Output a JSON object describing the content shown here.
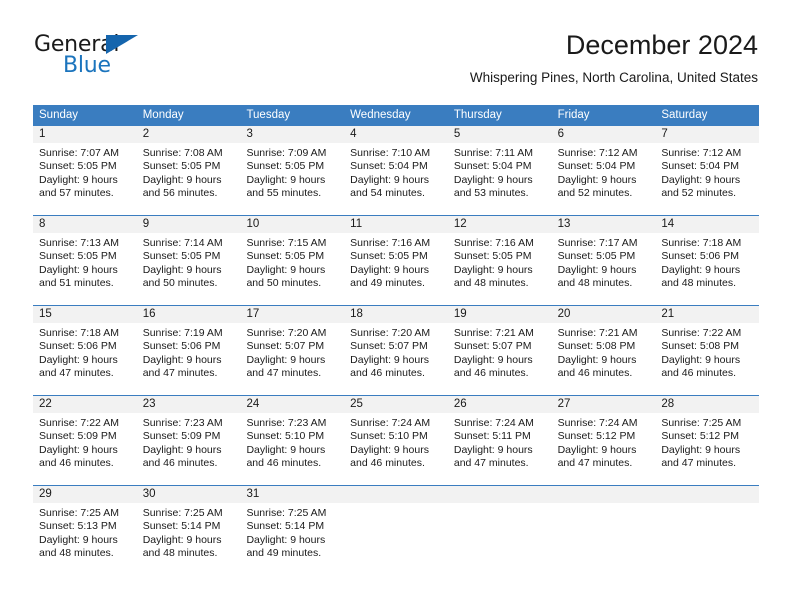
{
  "logo": {
    "word_one": "General",
    "word_two": "Blue",
    "triangle_color": "#1565ad",
    "blue_text_color": "#1b74bd"
  },
  "header": {
    "title": "December 2024",
    "subtitle": "Whispering Pines, North Carolina, United States"
  },
  "theme": {
    "header_bar_color": "#3a7dc0",
    "day_number_band_color": "#f2f2f2",
    "text_color": "#1a1a1a"
  },
  "calendar": {
    "weekday_headers": [
      "Sunday",
      "Monday",
      "Tuesday",
      "Wednesday",
      "Thursday",
      "Friday",
      "Saturday"
    ],
    "weeks": [
      [
        {
          "day": "1",
          "sunrise": "Sunrise: 7:07 AM",
          "sunset": "Sunset: 5:05 PM",
          "daylight_1": "Daylight: 9 hours",
          "daylight_2": "and 57 minutes."
        },
        {
          "day": "2",
          "sunrise": "Sunrise: 7:08 AM",
          "sunset": "Sunset: 5:05 PM",
          "daylight_1": "Daylight: 9 hours",
          "daylight_2": "and 56 minutes."
        },
        {
          "day": "3",
          "sunrise": "Sunrise: 7:09 AM",
          "sunset": "Sunset: 5:05 PM",
          "daylight_1": "Daylight: 9 hours",
          "daylight_2": "and 55 minutes."
        },
        {
          "day": "4",
          "sunrise": "Sunrise: 7:10 AM",
          "sunset": "Sunset: 5:04 PM",
          "daylight_1": "Daylight: 9 hours",
          "daylight_2": "and 54 minutes."
        },
        {
          "day": "5",
          "sunrise": "Sunrise: 7:11 AM",
          "sunset": "Sunset: 5:04 PM",
          "daylight_1": "Daylight: 9 hours",
          "daylight_2": "and 53 minutes."
        },
        {
          "day": "6",
          "sunrise": "Sunrise: 7:12 AM",
          "sunset": "Sunset: 5:04 PM",
          "daylight_1": "Daylight: 9 hours",
          "daylight_2": "and 52 minutes."
        },
        {
          "day": "7",
          "sunrise": "Sunrise: 7:12 AM",
          "sunset": "Sunset: 5:04 PM",
          "daylight_1": "Daylight: 9 hours",
          "daylight_2": "and 52 minutes."
        }
      ],
      [
        {
          "day": "8",
          "sunrise": "Sunrise: 7:13 AM",
          "sunset": "Sunset: 5:05 PM",
          "daylight_1": "Daylight: 9 hours",
          "daylight_2": "and 51 minutes."
        },
        {
          "day": "9",
          "sunrise": "Sunrise: 7:14 AM",
          "sunset": "Sunset: 5:05 PM",
          "daylight_1": "Daylight: 9 hours",
          "daylight_2": "and 50 minutes."
        },
        {
          "day": "10",
          "sunrise": "Sunrise: 7:15 AM",
          "sunset": "Sunset: 5:05 PM",
          "daylight_1": "Daylight: 9 hours",
          "daylight_2": "and 50 minutes."
        },
        {
          "day": "11",
          "sunrise": "Sunrise: 7:16 AM",
          "sunset": "Sunset: 5:05 PM",
          "daylight_1": "Daylight: 9 hours",
          "daylight_2": "and 49 minutes."
        },
        {
          "day": "12",
          "sunrise": "Sunrise: 7:16 AM",
          "sunset": "Sunset: 5:05 PM",
          "daylight_1": "Daylight: 9 hours",
          "daylight_2": "and 48 minutes."
        },
        {
          "day": "13",
          "sunrise": "Sunrise: 7:17 AM",
          "sunset": "Sunset: 5:05 PM",
          "daylight_1": "Daylight: 9 hours",
          "daylight_2": "and 48 minutes."
        },
        {
          "day": "14",
          "sunrise": "Sunrise: 7:18 AM",
          "sunset": "Sunset: 5:06 PM",
          "daylight_1": "Daylight: 9 hours",
          "daylight_2": "and 48 minutes."
        }
      ],
      [
        {
          "day": "15",
          "sunrise": "Sunrise: 7:18 AM",
          "sunset": "Sunset: 5:06 PM",
          "daylight_1": "Daylight: 9 hours",
          "daylight_2": "and 47 minutes."
        },
        {
          "day": "16",
          "sunrise": "Sunrise: 7:19 AM",
          "sunset": "Sunset: 5:06 PM",
          "daylight_1": "Daylight: 9 hours",
          "daylight_2": "and 47 minutes."
        },
        {
          "day": "17",
          "sunrise": "Sunrise: 7:20 AM",
          "sunset": "Sunset: 5:07 PM",
          "daylight_1": "Daylight: 9 hours",
          "daylight_2": "and 47 minutes."
        },
        {
          "day": "18",
          "sunrise": "Sunrise: 7:20 AM",
          "sunset": "Sunset: 5:07 PM",
          "daylight_1": "Daylight: 9 hours",
          "daylight_2": "and 46 minutes."
        },
        {
          "day": "19",
          "sunrise": "Sunrise: 7:21 AM",
          "sunset": "Sunset: 5:07 PM",
          "daylight_1": "Daylight: 9 hours",
          "daylight_2": "and 46 minutes."
        },
        {
          "day": "20",
          "sunrise": "Sunrise: 7:21 AM",
          "sunset": "Sunset: 5:08 PM",
          "daylight_1": "Daylight: 9 hours",
          "daylight_2": "and 46 minutes."
        },
        {
          "day": "21",
          "sunrise": "Sunrise: 7:22 AM",
          "sunset": "Sunset: 5:08 PM",
          "daylight_1": "Daylight: 9 hours",
          "daylight_2": "and 46 minutes."
        }
      ],
      [
        {
          "day": "22",
          "sunrise": "Sunrise: 7:22 AM",
          "sunset": "Sunset: 5:09 PM",
          "daylight_1": "Daylight: 9 hours",
          "daylight_2": "and 46 minutes."
        },
        {
          "day": "23",
          "sunrise": "Sunrise: 7:23 AM",
          "sunset": "Sunset: 5:09 PM",
          "daylight_1": "Daylight: 9 hours",
          "daylight_2": "and 46 minutes."
        },
        {
          "day": "24",
          "sunrise": "Sunrise: 7:23 AM",
          "sunset": "Sunset: 5:10 PM",
          "daylight_1": "Daylight: 9 hours",
          "daylight_2": "and 46 minutes."
        },
        {
          "day": "25",
          "sunrise": "Sunrise: 7:24 AM",
          "sunset": "Sunset: 5:10 PM",
          "daylight_1": "Daylight: 9 hours",
          "daylight_2": "and 46 minutes."
        },
        {
          "day": "26",
          "sunrise": "Sunrise: 7:24 AM",
          "sunset": "Sunset: 5:11 PM",
          "daylight_1": "Daylight: 9 hours",
          "daylight_2": "and 47 minutes."
        },
        {
          "day": "27",
          "sunrise": "Sunrise: 7:24 AM",
          "sunset": "Sunset: 5:12 PM",
          "daylight_1": "Daylight: 9 hours",
          "daylight_2": "and 47 minutes."
        },
        {
          "day": "28",
          "sunrise": "Sunrise: 7:25 AM",
          "sunset": "Sunset: 5:12 PM",
          "daylight_1": "Daylight: 9 hours",
          "daylight_2": "and 47 minutes."
        }
      ],
      [
        {
          "day": "29",
          "sunrise": "Sunrise: 7:25 AM",
          "sunset": "Sunset: 5:13 PM",
          "daylight_1": "Daylight: 9 hours",
          "daylight_2": "and 48 minutes."
        },
        {
          "day": "30",
          "sunrise": "Sunrise: 7:25 AM",
          "sunset": "Sunset: 5:14 PM",
          "daylight_1": "Daylight: 9 hours",
          "daylight_2": "and 48 minutes."
        },
        {
          "day": "31",
          "sunrise": "Sunrise: 7:25 AM",
          "sunset": "Sunset: 5:14 PM",
          "daylight_1": "Daylight: 9 hours",
          "daylight_2": "and 49 minutes."
        },
        {
          "day": "",
          "sunrise": "",
          "sunset": "",
          "daylight_1": "",
          "daylight_2": ""
        },
        {
          "day": "",
          "sunrise": "",
          "sunset": "",
          "daylight_1": "",
          "daylight_2": ""
        },
        {
          "day": "",
          "sunrise": "",
          "sunset": "",
          "daylight_1": "",
          "daylight_2": ""
        },
        {
          "day": "",
          "sunrise": "",
          "sunset": "",
          "daylight_1": "",
          "daylight_2": ""
        }
      ]
    ]
  }
}
